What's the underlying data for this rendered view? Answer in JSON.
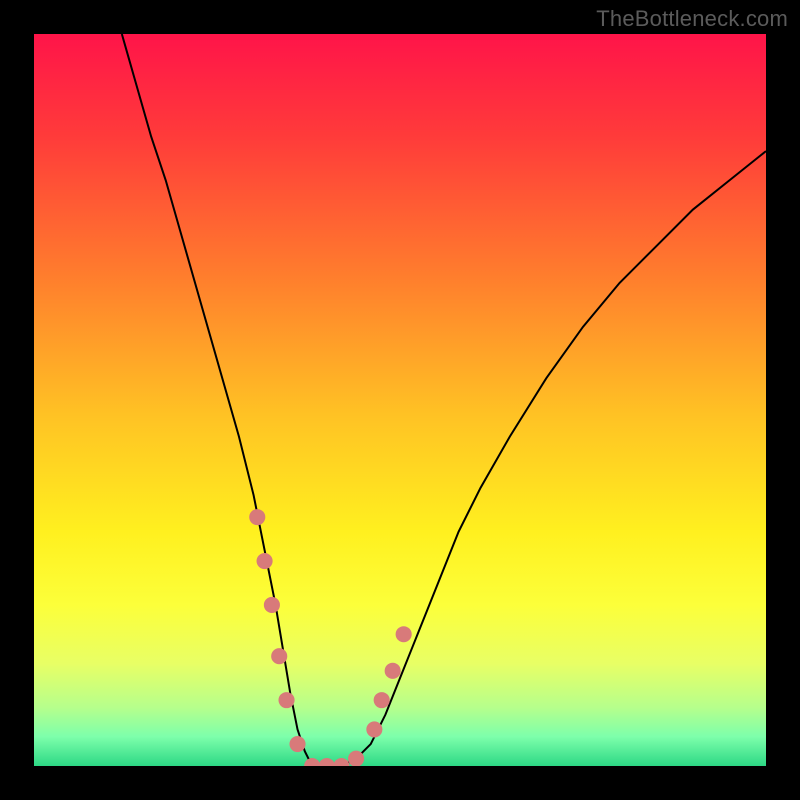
{
  "watermark": {
    "text": "TheBottleneck.com"
  },
  "chart_data": {
    "type": "line",
    "title": "",
    "xlabel": "",
    "ylabel": "",
    "xrange": [
      0,
      100
    ],
    "yrange": [
      0,
      100
    ],
    "grid": false,
    "legend": false,
    "background_gradient_stops": [
      {
        "offset": 0.0,
        "color": "#ff1449"
      },
      {
        "offset": 0.14,
        "color": "#ff3b3a"
      },
      {
        "offset": 0.33,
        "color": "#ff7d2d"
      },
      {
        "offset": 0.52,
        "color": "#ffc224"
      },
      {
        "offset": 0.68,
        "color": "#fff01f"
      },
      {
        "offset": 0.78,
        "color": "#fcff3a"
      },
      {
        "offset": 0.86,
        "color": "#e8ff65"
      },
      {
        "offset": 0.92,
        "color": "#b6ff8c"
      },
      {
        "offset": 0.96,
        "color": "#7dffab"
      },
      {
        "offset": 1.0,
        "color": "#2dd885"
      }
    ],
    "series": [
      {
        "name": "bottleneck-curve",
        "color": "#000000",
        "x": [
          12,
          14,
          16,
          18,
          20,
          22,
          24,
          26,
          28,
          30,
          31,
          32,
          33,
          34,
          35,
          36,
          37,
          38,
          39,
          40,
          42,
          44,
          46,
          48,
          50,
          52,
          54,
          56,
          58,
          61,
          65,
          70,
          75,
          80,
          85,
          90,
          95,
          100
        ],
        "values": [
          100,
          93,
          86,
          80,
          73,
          66,
          59,
          52,
          45,
          37,
          32,
          27,
          22,
          16,
          10,
          5,
          2,
          0,
          0,
          0,
          0,
          1,
          3,
          7,
          12,
          17,
          22,
          27,
          32,
          38,
          45,
          53,
          60,
          66,
          71,
          76,
          80,
          84
        ]
      }
    ],
    "markers": {
      "name": "highlight-dots",
      "color": "#d87a7a",
      "radius_percent": 1.1,
      "points": [
        {
          "x": 30.5,
          "y": 34
        },
        {
          "x": 31.5,
          "y": 28
        },
        {
          "x": 32.5,
          "y": 22
        },
        {
          "x": 33.5,
          "y": 15
        },
        {
          "x": 34.5,
          "y": 9
        },
        {
          "x": 36.0,
          "y": 3
        },
        {
          "x": 38.0,
          "y": 0
        },
        {
          "x": 40.0,
          "y": 0
        },
        {
          "x": 42.0,
          "y": 0
        },
        {
          "x": 44.0,
          "y": 1
        },
        {
          "x": 46.5,
          "y": 5
        },
        {
          "x": 47.5,
          "y": 9
        },
        {
          "x": 49.0,
          "y": 13
        },
        {
          "x": 50.5,
          "y": 18
        }
      ]
    }
  }
}
